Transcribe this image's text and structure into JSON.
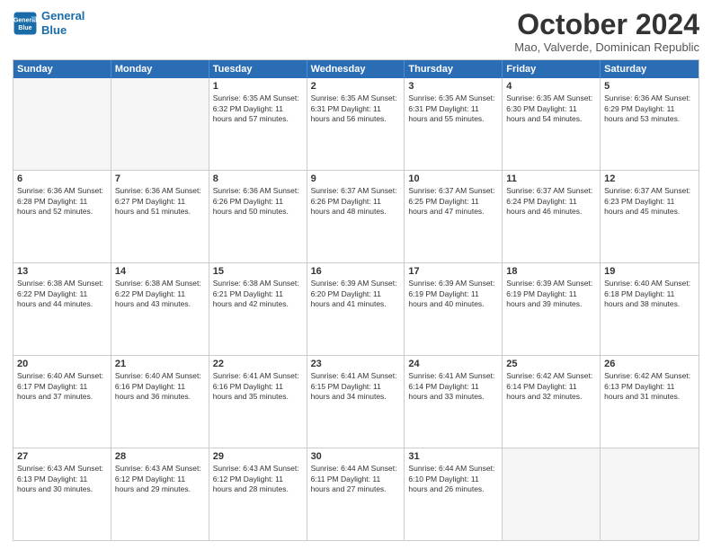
{
  "logo": {
    "line1": "General",
    "line2": "Blue"
  },
  "title": "October 2024",
  "subtitle": "Mao, Valverde, Dominican Republic",
  "header_days": [
    "Sunday",
    "Monday",
    "Tuesday",
    "Wednesday",
    "Thursday",
    "Friday",
    "Saturday"
  ],
  "weeks": [
    [
      {
        "day": "",
        "detail": "",
        "empty": true
      },
      {
        "day": "",
        "detail": "",
        "empty": true
      },
      {
        "day": "1",
        "detail": "Sunrise: 6:35 AM\nSunset: 6:32 PM\nDaylight: 11 hours and 57 minutes."
      },
      {
        "day": "2",
        "detail": "Sunrise: 6:35 AM\nSunset: 6:31 PM\nDaylight: 11 hours and 56 minutes."
      },
      {
        "day": "3",
        "detail": "Sunrise: 6:35 AM\nSunset: 6:31 PM\nDaylight: 11 hours and 55 minutes."
      },
      {
        "day": "4",
        "detail": "Sunrise: 6:35 AM\nSunset: 6:30 PM\nDaylight: 11 hours and 54 minutes."
      },
      {
        "day": "5",
        "detail": "Sunrise: 6:36 AM\nSunset: 6:29 PM\nDaylight: 11 hours and 53 minutes."
      }
    ],
    [
      {
        "day": "6",
        "detail": "Sunrise: 6:36 AM\nSunset: 6:28 PM\nDaylight: 11 hours and 52 minutes."
      },
      {
        "day": "7",
        "detail": "Sunrise: 6:36 AM\nSunset: 6:27 PM\nDaylight: 11 hours and 51 minutes."
      },
      {
        "day": "8",
        "detail": "Sunrise: 6:36 AM\nSunset: 6:26 PM\nDaylight: 11 hours and 50 minutes."
      },
      {
        "day": "9",
        "detail": "Sunrise: 6:37 AM\nSunset: 6:26 PM\nDaylight: 11 hours and 48 minutes."
      },
      {
        "day": "10",
        "detail": "Sunrise: 6:37 AM\nSunset: 6:25 PM\nDaylight: 11 hours and 47 minutes."
      },
      {
        "day": "11",
        "detail": "Sunrise: 6:37 AM\nSunset: 6:24 PM\nDaylight: 11 hours and 46 minutes."
      },
      {
        "day": "12",
        "detail": "Sunrise: 6:37 AM\nSunset: 6:23 PM\nDaylight: 11 hours and 45 minutes."
      }
    ],
    [
      {
        "day": "13",
        "detail": "Sunrise: 6:38 AM\nSunset: 6:22 PM\nDaylight: 11 hours and 44 minutes."
      },
      {
        "day": "14",
        "detail": "Sunrise: 6:38 AM\nSunset: 6:22 PM\nDaylight: 11 hours and 43 minutes."
      },
      {
        "day": "15",
        "detail": "Sunrise: 6:38 AM\nSunset: 6:21 PM\nDaylight: 11 hours and 42 minutes."
      },
      {
        "day": "16",
        "detail": "Sunrise: 6:39 AM\nSunset: 6:20 PM\nDaylight: 11 hours and 41 minutes."
      },
      {
        "day": "17",
        "detail": "Sunrise: 6:39 AM\nSunset: 6:19 PM\nDaylight: 11 hours and 40 minutes."
      },
      {
        "day": "18",
        "detail": "Sunrise: 6:39 AM\nSunset: 6:19 PM\nDaylight: 11 hours and 39 minutes."
      },
      {
        "day": "19",
        "detail": "Sunrise: 6:40 AM\nSunset: 6:18 PM\nDaylight: 11 hours and 38 minutes."
      }
    ],
    [
      {
        "day": "20",
        "detail": "Sunrise: 6:40 AM\nSunset: 6:17 PM\nDaylight: 11 hours and 37 minutes."
      },
      {
        "day": "21",
        "detail": "Sunrise: 6:40 AM\nSunset: 6:16 PM\nDaylight: 11 hours and 36 minutes."
      },
      {
        "day": "22",
        "detail": "Sunrise: 6:41 AM\nSunset: 6:16 PM\nDaylight: 11 hours and 35 minutes."
      },
      {
        "day": "23",
        "detail": "Sunrise: 6:41 AM\nSunset: 6:15 PM\nDaylight: 11 hours and 34 minutes."
      },
      {
        "day": "24",
        "detail": "Sunrise: 6:41 AM\nSunset: 6:14 PM\nDaylight: 11 hours and 33 minutes."
      },
      {
        "day": "25",
        "detail": "Sunrise: 6:42 AM\nSunset: 6:14 PM\nDaylight: 11 hours and 32 minutes."
      },
      {
        "day": "26",
        "detail": "Sunrise: 6:42 AM\nSunset: 6:13 PM\nDaylight: 11 hours and 31 minutes."
      }
    ],
    [
      {
        "day": "27",
        "detail": "Sunrise: 6:43 AM\nSunset: 6:13 PM\nDaylight: 11 hours and 30 minutes."
      },
      {
        "day": "28",
        "detail": "Sunrise: 6:43 AM\nSunset: 6:12 PM\nDaylight: 11 hours and 29 minutes."
      },
      {
        "day": "29",
        "detail": "Sunrise: 6:43 AM\nSunset: 6:12 PM\nDaylight: 11 hours and 28 minutes."
      },
      {
        "day": "30",
        "detail": "Sunrise: 6:44 AM\nSunset: 6:11 PM\nDaylight: 11 hours and 27 minutes."
      },
      {
        "day": "31",
        "detail": "Sunrise: 6:44 AM\nSunset: 6:10 PM\nDaylight: 11 hours and 26 minutes."
      },
      {
        "day": "",
        "detail": "",
        "empty": true
      },
      {
        "day": "",
        "detail": "",
        "empty": true
      }
    ]
  ]
}
